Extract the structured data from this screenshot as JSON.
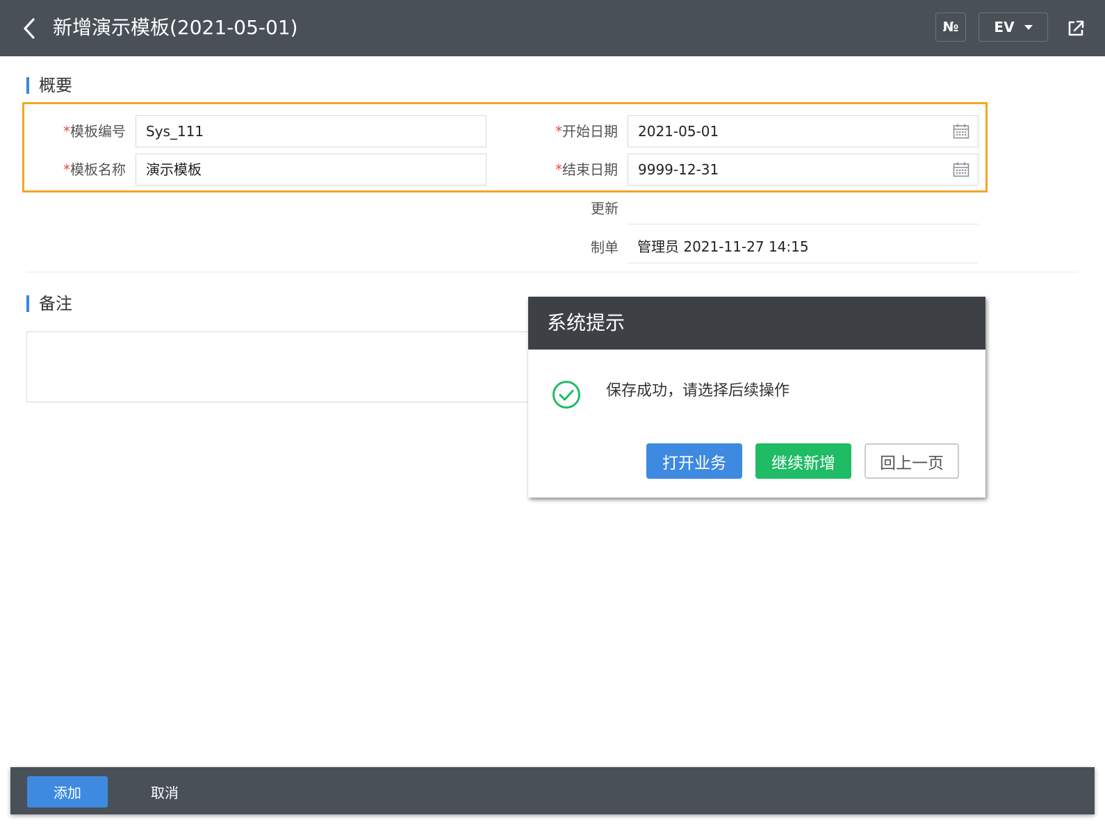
{
  "header": {
    "title": "新增演示模板(2021-05-01)",
    "number_label": "№",
    "lang_label": "EV",
    "back_icon": "chevron-left-icon",
    "share_icon": "share-external-icon"
  },
  "overview": {
    "section_title": "概要",
    "fields": {
      "template_code": {
        "label": "模板编号",
        "value": "Sys_111",
        "required": true
      },
      "template_name": {
        "label": "模板名称",
        "value": "演示模板",
        "required": true
      },
      "start_date": {
        "label": "开始日期",
        "value": "2021-05-01",
        "required": true
      },
      "end_date": {
        "label": "结束日期",
        "value": "9999-12-31",
        "required": true
      },
      "updated": {
        "label": "更新",
        "value": ""
      },
      "created_by": {
        "label": "制单",
        "value": "管理员 2021-11-27 14:15"
      }
    },
    "required_mark": "*"
  },
  "remarks": {
    "section_title": "备注",
    "value": ""
  },
  "dialog": {
    "title": "系统提示",
    "message": "保存成功，请选择后续操作",
    "buttons": {
      "open": "打开业务",
      "continue": "继续新增",
      "back": "回上一页"
    }
  },
  "footer": {
    "add_label": "添加",
    "cancel_label": "取消"
  },
  "colors": {
    "header_bg": "#4a5058",
    "highlight_border": "#f4a623",
    "primary_blue": "#3e8ae0",
    "success_green": "#1fbc65",
    "required_red": "#e24c4c"
  }
}
